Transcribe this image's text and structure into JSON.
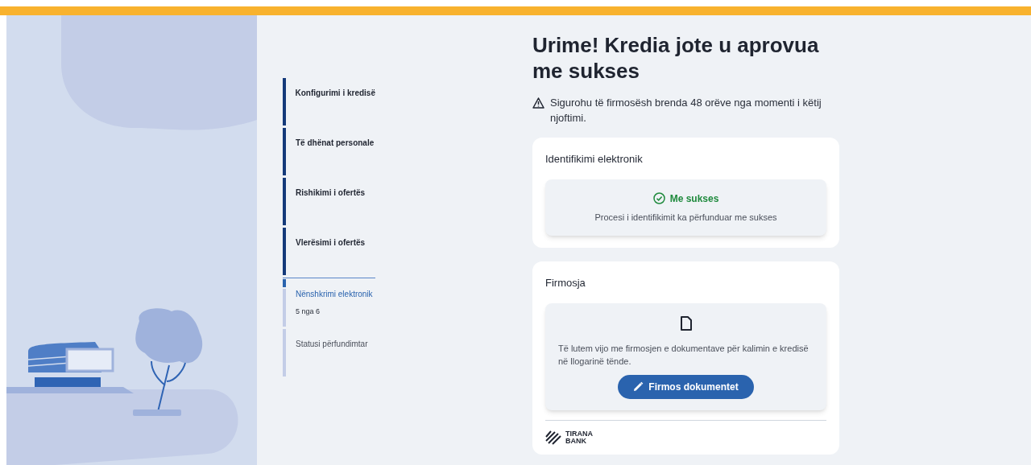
{
  "steps": [
    {
      "label": "Konfigurimi i kredisë",
      "kind": "done"
    },
    {
      "label": "Të dhënat personale",
      "kind": "done"
    },
    {
      "label": "Rishikimi i ofertës",
      "kind": "done"
    },
    {
      "label": "Vlerësimi i ofertës",
      "kind": "done"
    },
    {
      "label": "Nënshkrimi elektronik",
      "kind": "current",
      "progress": "5 nga 6"
    },
    {
      "label": "Statusi përfundimtar",
      "kind": "pending"
    }
  ],
  "title": "Urime! Kredia jote u aprovua me sukses",
  "warning": "Sigurohu të firmosësh brenda 48 orëve nga momenti i këtij njoftimi.",
  "identification_card": {
    "title": "Identifikimi elektronik",
    "status": "Me sukses",
    "message": "Procesi i identifikimit ka përfunduar me sukses"
  },
  "signing_card": {
    "title": "Firmosja",
    "message": "Të lutem vijo me firmosjen e dokumentave për kalimin e kredisë në llogarinë tënde.",
    "button": "Firmos dokumentet",
    "logo_line_1": "TIRANA",
    "logo_line_2": "BANK"
  }
}
